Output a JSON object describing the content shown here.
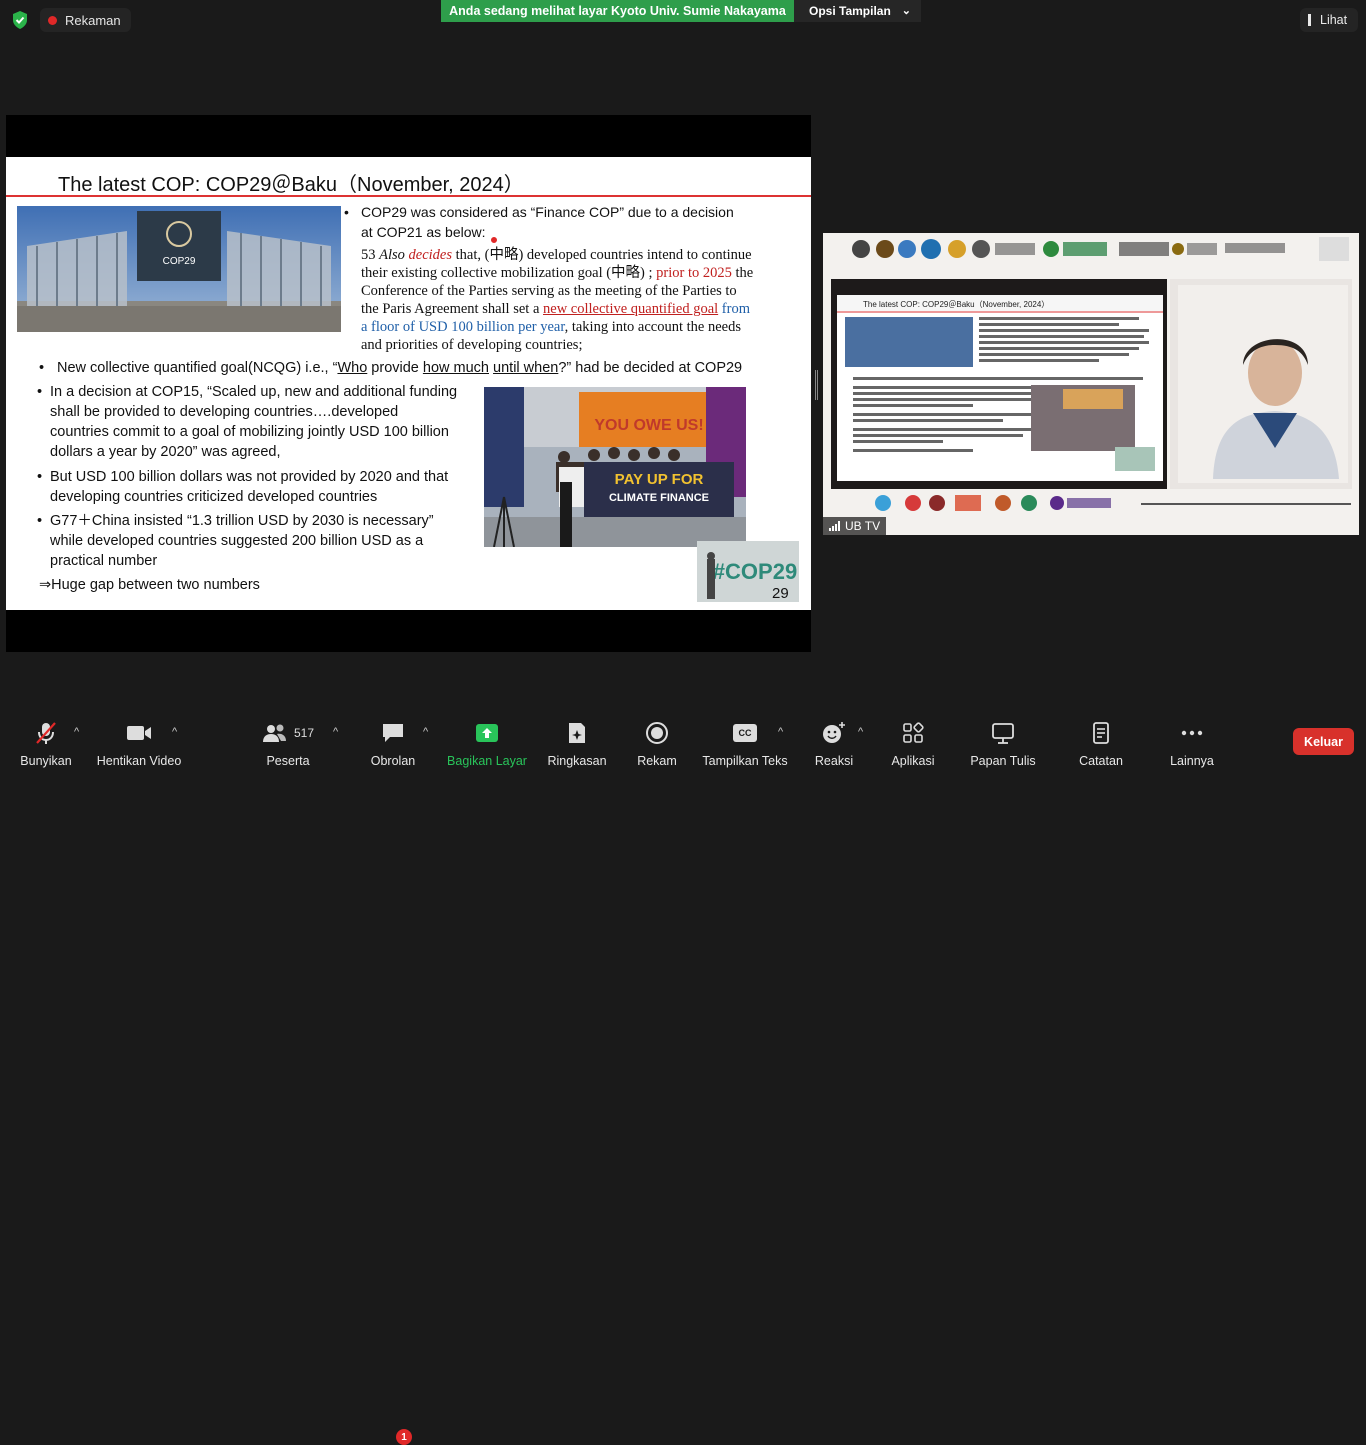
{
  "topbar": {
    "recording_label": "Rekaman",
    "banner_text": "Anda sedang melihat layar Kyoto Univ. Sumie Nakayama",
    "view_options_label": "Opsi Tampilan",
    "view_label": "Lihat"
  },
  "slide": {
    "title": "The latest COP: COP29＠Baku（November, 2024）",
    "bullet1_line1": "COP29 was considered as “Finance COP” due to a decision",
    "bullet1_line2": "at COP21 as below:",
    "quote_num": "53",
    "quote_also": "Also",
    "quote_decides": "decides",
    "quote_l1_rest": "that, (中略) developed countries intend to continue",
    "quote_l2a": "their existing collective mobilization goal (中略) ;",
    "quote_prior": "prior to 2025",
    "quote_l2b": "the",
    "quote_l3": "Conference of the Parties serving as the meeting of the Parties to",
    "quote_l4a": "the Paris Agreement shall set a",
    "quote_ncqg": "new collective quantified goal",
    "quote_from": "from",
    "quote_floor": "a floor of USD 100 billion per year",
    "quote_l5b": ", taking into account the needs",
    "quote_l6": "and priorities of developing countries;",
    "ncqg_a": "New collective quantified goal(NCQG) i.e., “",
    "ncqg_who": "Who",
    "ncqg_provide": " provide ",
    "ncqg_howmuch": "how much",
    "ncqg_sp": " ",
    "ncqg_until": "until when",
    "ncqg_b": "?” had be decided at COP29",
    "cop15_l1": "In a decision at COP15, “Scaled up, new and additional funding",
    "cop15_l2": "shall be provided to developing countries….developed",
    "cop15_l3": "countries commit to a goal of mobilizing jointly USD 100 billion",
    "cop15_l4": "dollars a year by 2020” was agreed,",
    "usd_l1": "But USD 100 billion dollars was not provided by 2020 and that",
    "usd_l2": "developing countries criticized developed countries",
    "g77_l1": "G77＋China insisted “1.3 trillion USD by 2030 is necessary”",
    "g77_l2": "while developed countries suggested 200 billion USD as a",
    "g77_l3": "practical number",
    "gap": "⇒Huge gap between two numbers",
    "page_number": "29",
    "photo_protest_banner1": "YOU OWE US!",
    "photo_protest_banner2": "PAY UP FOR",
    "photo_protest_banner3": "CLIMATE FINANCE",
    "photo_cop_sign": "#COP29",
    "photo_venue_logo": "COP29"
  },
  "video": {
    "participant_name": "UB TV",
    "thumb_title": "The latest COP: COP29＠Baku（November, 2024）"
  },
  "toolbar": {
    "mute": "Bunyikan",
    "video": "Hentikan Video",
    "participants": "Peserta",
    "participants_count": "517",
    "chat": "Obrolan",
    "chat_badge": "1",
    "share": "Bagikan Layar",
    "summary": "Ringkasan",
    "record": "Rekam",
    "captions": "Tampilkan Teks",
    "captions_icon": "CC",
    "reactions": "Reaksi",
    "apps": "Aplikasi",
    "whiteboard": "Papan Tulis",
    "notes": "Catatan",
    "more": "Lainnya",
    "leave": "Keluar"
  },
  "colors": {
    "banner_green": "#2e9e4b",
    "share_icon_green": "#29c45a",
    "leave_red": "#d8312b",
    "slide_red": "#c0201f",
    "slide_blue": "#1f5fa8"
  }
}
